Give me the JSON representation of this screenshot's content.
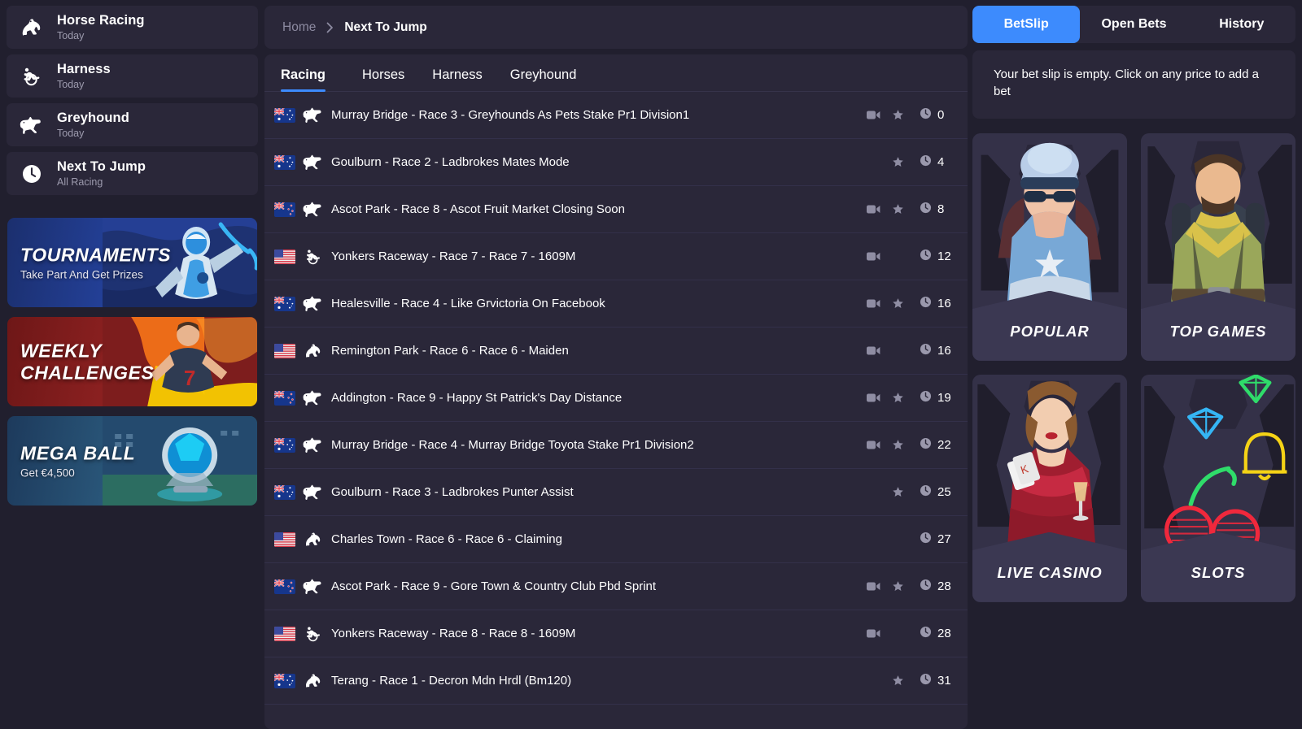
{
  "sidebar": {
    "items": [
      {
        "title": "Horse Racing",
        "subtitle": "Today",
        "icon": "horse-icon"
      },
      {
        "title": "Harness",
        "subtitle": "Today",
        "icon": "harness-icon"
      },
      {
        "title": "Greyhound",
        "subtitle": "Today",
        "icon": "greyhound-icon"
      },
      {
        "title": "Next To Jump",
        "subtitle": "All Racing",
        "icon": "clock-icon"
      }
    ],
    "promos": [
      {
        "title": "TOURNAMENTS",
        "subtitle": "Take Part And Get Prizes"
      },
      {
        "title": "WEEKLY\nCHALLENGES",
        "subtitle": ""
      },
      {
        "title": "MEGA BALL",
        "subtitle": "Get €4,500"
      }
    ]
  },
  "breadcrumb": {
    "home": "Home",
    "current": "Next To Jump",
    "separator": "chevron-right-icon"
  },
  "tabs": [
    {
      "label": "Racing",
      "active": true
    },
    {
      "label": "Horses",
      "active": false
    },
    {
      "label": "Harness",
      "active": false
    },
    {
      "label": "Greyhound",
      "active": false
    }
  ],
  "races": [
    {
      "country": "AU",
      "sport": "greyhound",
      "name": "Murray Bridge - Race 3 - Greyhounds As Pets Stake Pr1 Division1",
      "video": true,
      "star": true,
      "time": "0"
    },
    {
      "country": "AU",
      "sport": "greyhound",
      "name": "Goulburn - Race 2 - Ladbrokes Mates Mode",
      "video": false,
      "star": true,
      "time": "4"
    },
    {
      "country": "NZ",
      "sport": "greyhound",
      "name": "Ascot Park - Race 8 - Ascot Fruit Market Closing Soon",
      "video": true,
      "star": true,
      "time": "8"
    },
    {
      "country": "US",
      "sport": "harness",
      "name": "Yonkers Raceway - Race 7 - Race 7 - 1609M",
      "video": true,
      "star": false,
      "time": "12"
    },
    {
      "country": "AU",
      "sport": "greyhound",
      "name": "Healesville - Race 4 - Like Grvictoria On Facebook",
      "video": true,
      "star": true,
      "time": "16"
    },
    {
      "country": "US",
      "sport": "horse",
      "name": "Remington Park - Race 6 - Race 6 - Maiden",
      "video": true,
      "star": false,
      "time": "16"
    },
    {
      "country": "NZ",
      "sport": "greyhound",
      "name": "Addington - Race 9 - Happy St Patrick's Day Distance",
      "video": true,
      "star": true,
      "time": "19"
    },
    {
      "country": "AU",
      "sport": "greyhound",
      "name": "Murray Bridge - Race 4 - Murray Bridge Toyota Stake Pr1 Division2",
      "video": true,
      "star": true,
      "time": "22"
    },
    {
      "country": "AU",
      "sport": "greyhound",
      "name": "Goulburn - Race 3 - Ladbrokes Punter Assist",
      "video": false,
      "star": true,
      "time": "25"
    },
    {
      "country": "US",
      "sport": "horse",
      "name": "Charles Town - Race 6 - Race 6 - Claiming",
      "video": false,
      "star": false,
      "time": "27"
    },
    {
      "country": "NZ",
      "sport": "greyhound",
      "name": "Ascot Park - Race 9 - Gore Town & Country Club Pbd Sprint",
      "video": true,
      "star": true,
      "time": "28"
    },
    {
      "country": "US",
      "sport": "harness",
      "name": "Yonkers Raceway - Race 8 - Race 8 - 1609M",
      "video": true,
      "star": false,
      "time": "28"
    },
    {
      "country": "AU",
      "sport": "horse",
      "name": "Terang - Race 1 - Decron Mdn Hrdl (Bm120)",
      "video": false,
      "star": true,
      "time": "31"
    }
  ],
  "betslip": {
    "tabs": [
      {
        "label": "BetSlip",
        "active": true
      },
      {
        "label": "Open Bets",
        "active": false
      },
      {
        "label": "History",
        "active": false
      }
    ],
    "empty_message": "Your bet slip is empty. Click on any price to add a bet"
  },
  "games": [
    {
      "label": "POPULAR",
      "art": "police-woman"
    },
    {
      "label": "TOP GAMES",
      "art": "explorer-man"
    },
    {
      "label": "LIVE CASINO",
      "art": "casino-woman"
    },
    {
      "label": "SLOTS",
      "art": "neon-symbols"
    }
  ],
  "colors": {
    "accent": "#3d8bfd",
    "page_bg": "#211f2e",
    "panel_bg": "#2a2739",
    "divider": "#33304a",
    "muted_text": "#9d9bae"
  }
}
